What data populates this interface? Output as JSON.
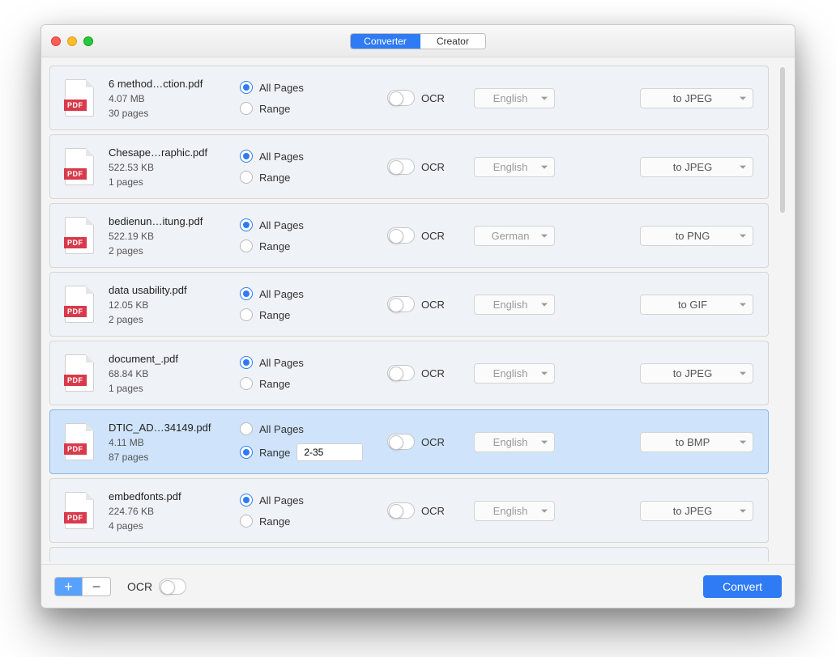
{
  "header": {
    "tabs": [
      "Converter",
      "Creator"
    ],
    "activeTab": 0
  },
  "labels": {
    "allPages": "All Pages",
    "range": "Range",
    "ocr": "OCR",
    "pdfBadge": "PDF"
  },
  "footer": {
    "ocrLabel": "OCR",
    "ocrOn": false,
    "convertLabel": "Convert"
  },
  "files": [
    {
      "name": "6 method…ction.pdf",
      "size": "4.07 MB",
      "pages": "30 pages",
      "selection": "all",
      "rangeValue": "",
      "ocr": false,
      "language": "English",
      "format": "to JPEG",
      "selected": false
    },
    {
      "name": "Chesape…raphic.pdf",
      "size": "522.53 KB",
      "pages": "1 pages",
      "selection": "all",
      "rangeValue": "",
      "ocr": false,
      "language": "English",
      "format": "to JPEG",
      "selected": false
    },
    {
      "name": "bedienun…itung.pdf",
      "size": "522.19 KB",
      "pages": "2 pages",
      "selection": "all",
      "rangeValue": "",
      "ocr": false,
      "language": "German",
      "format": "to PNG",
      "selected": false
    },
    {
      "name": "data usability.pdf",
      "size": "12.05 KB",
      "pages": "2 pages",
      "selection": "all",
      "rangeValue": "",
      "ocr": false,
      "language": "English",
      "format": "to GIF",
      "selected": false
    },
    {
      "name": "document_.pdf",
      "size": "68.84 KB",
      "pages": "1 pages",
      "selection": "all",
      "rangeValue": "",
      "ocr": false,
      "language": "English",
      "format": "to JPEG",
      "selected": false
    },
    {
      "name": "DTIC_AD…34149.pdf",
      "size": "4.11 MB",
      "pages": "87 pages",
      "selection": "range",
      "rangeValue": "2-35",
      "ocr": false,
      "language": "English",
      "format": "to BMP",
      "selected": true
    },
    {
      "name": "embedfonts.pdf",
      "size": "224.76 KB",
      "pages": "4 pages",
      "selection": "all",
      "rangeValue": "",
      "ocr": false,
      "language": "English",
      "format": "to JPEG",
      "selected": false
    }
  ]
}
